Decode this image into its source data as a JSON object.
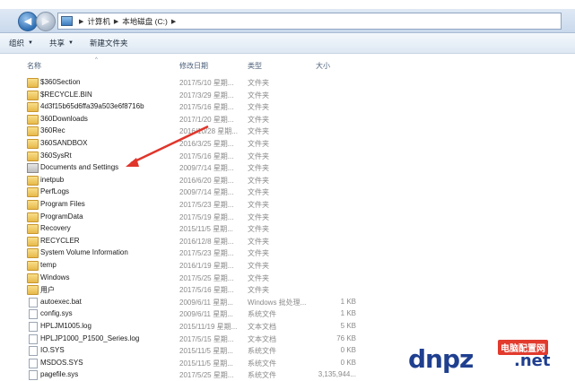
{
  "breadcrumb": {
    "items": [
      "计算机",
      "本地磁盘 (C:)"
    ]
  },
  "toolbar": {
    "organize": "组织",
    "share": "共享",
    "new_folder": "新建文件夹"
  },
  "columns": {
    "name": "名称",
    "date": "修改日期",
    "type": "类型",
    "size": "大小"
  },
  "rows": [
    {
      "icon": "folder",
      "name": "$360Section",
      "date": "2017/5/10 星期...",
      "type": "文件夹",
      "size": ""
    },
    {
      "icon": "folder",
      "name": "$RECYCLE.BIN",
      "date": "2017/3/29 星期...",
      "type": "文件夹",
      "size": ""
    },
    {
      "icon": "folder-lock",
      "name": "4d3f15b65d6ffa39a503e6f8716b",
      "date": "2017/5/16 星期...",
      "type": "文件夹",
      "size": ""
    },
    {
      "icon": "folder",
      "name": "360Downloads",
      "date": "2017/1/20 星期...",
      "type": "文件夹",
      "size": ""
    },
    {
      "icon": "folder",
      "name": "360Rec",
      "date": "2016/10/28 星期...",
      "type": "文件夹",
      "size": ""
    },
    {
      "icon": "folder",
      "name": "360SANDBOX",
      "date": "2016/3/25 星期...",
      "type": "文件夹",
      "size": ""
    },
    {
      "icon": "folder",
      "name": "360SysRt",
      "date": "2017/5/16 星期...",
      "type": "文件夹",
      "size": ""
    },
    {
      "icon": "shortcut",
      "name": "Documents and Settings",
      "date": "2009/7/14 星期...",
      "type": "文件夹",
      "size": ""
    },
    {
      "icon": "folder",
      "name": "inetpub",
      "date": "2016/6/20 星期...",
      "type": "文件夹",
      "size": ""
    },
    {
      "icon": "folder",
      "name": "PerfLogs",
      "date": "2009/7/14 星期...",
      "type": "文件夹",
      "size": ""
    },
    {
      "icon": "folder",
      "name": "Program Files",
      "date": "2017/5/23 星期...",
      "type": "文件夹",
      "size": ""
    },
    {
      "icon": "folder",
      "name": "ProgramData",
      "date": "2017/5/19 星期...",
      "type": "文件夹",
      "size": ""
    },
    {
      "icon": "folder-lock",
      "name": "Recovery",
      "date": "2015/11/5 星期...",
      "type": "文件夹",
      "size": ""
    },
    {
      "icon": "folder-lock",
      "name": "RECYCLER",
      "date": "2016/12/8 星期...",
      "type": "文件夹",
      "size": ""
    },
    {
      "icon": "folder-lock",
      "name": "System Volume Information",
      "date": "2017/5/23 星期...",
      "type": "文件夹",
      "size": ""
    },
    {
      "icon": "folder",
      "name": "temp",
      "date": "2016/1/19 星期...",
      "type": "文件夹",
      "size": ""
    },
    {
      "icon": "folder",
      "name": "Windows",
      "date": "2017/5/25 星期...",
      "type": "文件夹",
      "size": ""
    },
    {
      "icon": "folder",
      "name": "用户",
      "date": "2017/5/16 星期...",
      "type": "文件夹",
      "size": ""
    },
    {
      "icon": "file",
      "name": "autoexec.bat",
      "date": "2009/6/11 星期...",
      "type": "Windows 批处理...",
      "size": "1 KB"
    },
    {
      "icon": "file",
      "name": "config.sys",
      "date": "2009/6/11 星期...",
      "type": "系统文件",
      "size": "1 KB"
    },
    {
      "icon": "file",
      "name": "HPLJM1005.log",
      "date": "2015/11/19 星期...",
      "type": "文本文档",
      "size": "5 KB"
    },
    {
      "icon": "file",
      "name": "HPLJP1000_P1500_Series.log",
      "date": "2017/5/15 星期...",
      "type": "文本文档",
      "size": "76 KB"
    },
    {
      "icon": "file",
      "name": "IO.SYS",
      "date": "2015/11/5 星期...",
      "type": "系统文件",
      "size": "0 KB"
    },
    {
      "icon": "file",
      "name": "MSDOS.SYS",
      "date": "2015/11/5 星期...",
      "type": "系统文件",
      "size": "0 KB"
    },
    {
      "icon": "file",
      "name": "pagefile.sys",
      "date": "2017/5/25 星期...",
      "type": "系统文件",
      "size": "3,135,944..."
    }
  ],
  "watermark": {
    "logo_text": "dnpz",
    "domain_suffix": ".net",
    "badge_text": "电脑配置网"
  },
  "colors": {
    "accent": "#2f6fb3",
    "arrow": "#e0352b",
    "watermark": "#1f3f8f"
  }
}
